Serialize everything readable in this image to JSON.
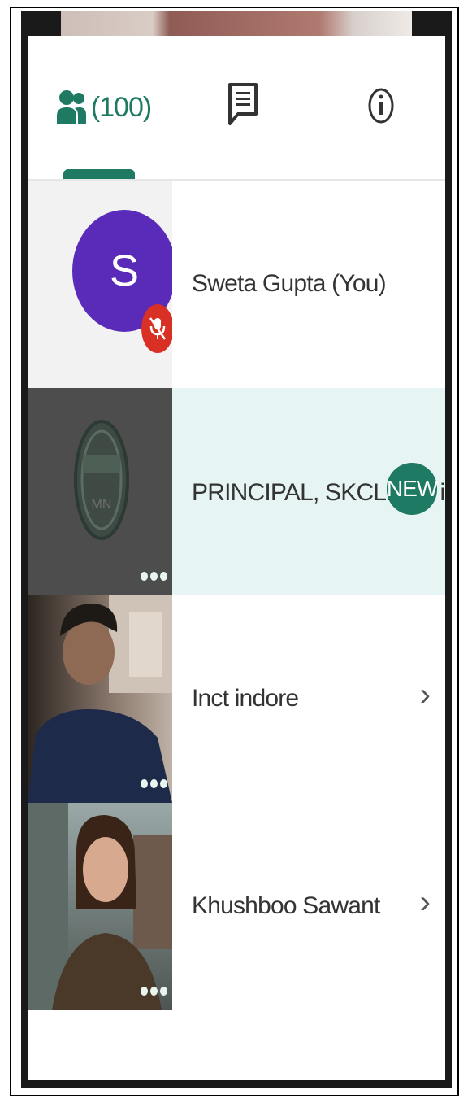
{
  "tabs": {
    "people_count": "(100)",
    "people_icon": "people-icon",
    "chat_icon": "chat-icon",
    "info_icon": "info-icon",
    "accent_color": "#1e7a62"
  },
  "participants": [
    {
      "name": "Sweta Gupta (You)",
      "avatar_letter": "S",
      "muted": true,
      "avatar_color": "#5a2bb8"
    },
    {
      "name": "PRINCIPAL, SKCLNCT i...",
      "badge": "NEW",
      "highlight_color": "#e6f4f4"
    },
    {
      "name": "Inct indore"
    },
    {
      "name": "Khushboo Sawant"
    }
  ]
}
